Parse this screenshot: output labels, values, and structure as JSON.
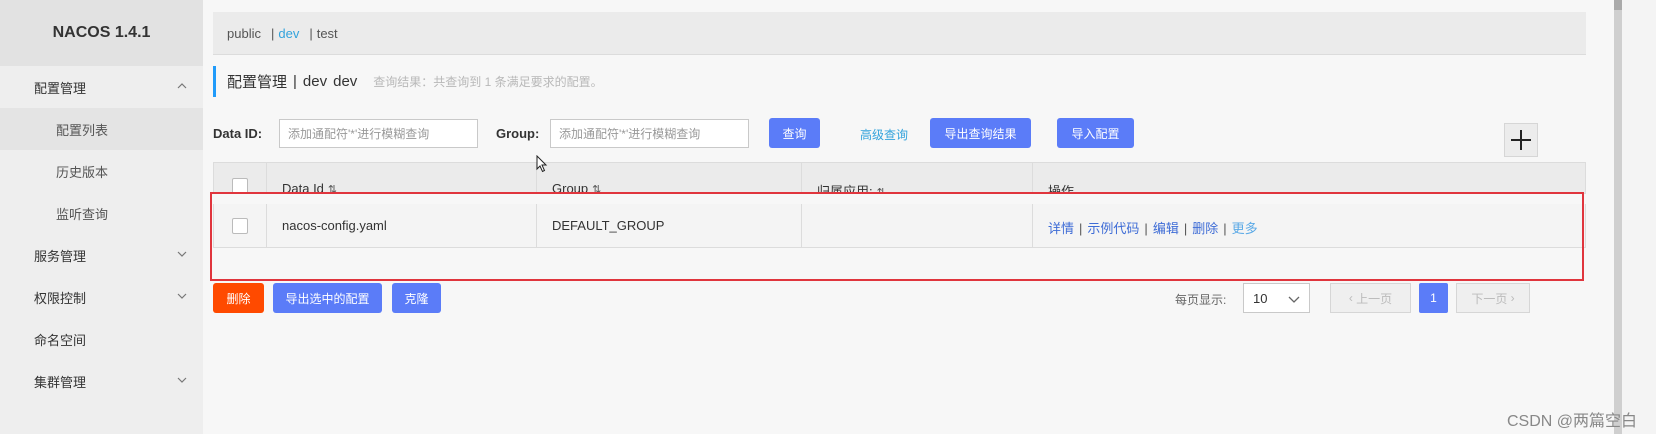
{
  "sidebar": {
    "logo": "NACOS 1.4.1",
    "items": [
      {
        "label": "配置管理",
        "type": "group",
        "expanded": true
      },
      {
        "label": "配置列表",
        "type": "sub",
        "active": true
      },
      {
        "label": "历史版本",
        "type": "sub"
      },
      {
        "label": "监听查询",
        "type": "sub"
      },
      {
        "label": "服务管理",
        "type": "group",
        "expanded": false
      },
      {
        "label": "权限控制",
        "type": "group",
        "expanded": false
      },
      {
        "label": "命名空间",
        "type": "item"
      },
      {
        "label": "集群管理",
        "type": "group",
        "expanded": false
      }
    ]
  },
  "namespaces": {
    "items": [
      "public",
      "dev",
      "test"
    ],
    "separator": "|",
    "active": "dev"
  },
  "header": {
    "title": "配置管理",
    "separator": "|",
    "ns_name": "dev",
    "ns_id": "dev",
    "result_hint": "查询结果：共查询到 1 条满足要求的配置。"
  },
  "search": {
    "dataid_label": "Data ID:",
    "dataid_placeholder": "添加通配符'*'进行模糊查询",
    "group_label": "Group:",
    "group_placeholder": "添加通配符'*'进行模糊查询",
    "query_label": "查询",
    "advanced_label": "高级查询",
    "export_label": "导出查询结果",
    "import_label": "导入配置",
    "add_label": "+"
  },
  "table": {
    "columns": [
      "Data Id",
      "Group",
      "归属应用:",
      "操作"
    ],
    "sort_glyph": "⇅",
    "rows": [
      {
        "data_id": "nacos-config.yaml",
        "group": "DEFAULT_GROUP",
        "app": ""
      }
    ],
    "actions": [
      "详情",
      "示例代码",
      "编辑",
      "删除",
      "更多"
    ],
    "action_separator": "|"
  },
  "footer": {
    "delete_label": "删除",
    "export_selected_label": "导出选中的配置",
    "clone_label": "克隆",
    "page_size_label": "每页显示:",
    "page_size": "10",
    "prev_label": "上一页",
    "current_page": "1",
    "next_label": "下一页"
  },
  "watermark": "CSDN @两篇空白",
  "colors": {
    "accent": "#5b7cf8",
    "danger": "#ff4a00",
    "link": "#33a3dc",
    "highlight_box": "#e0353d"
  }
}
